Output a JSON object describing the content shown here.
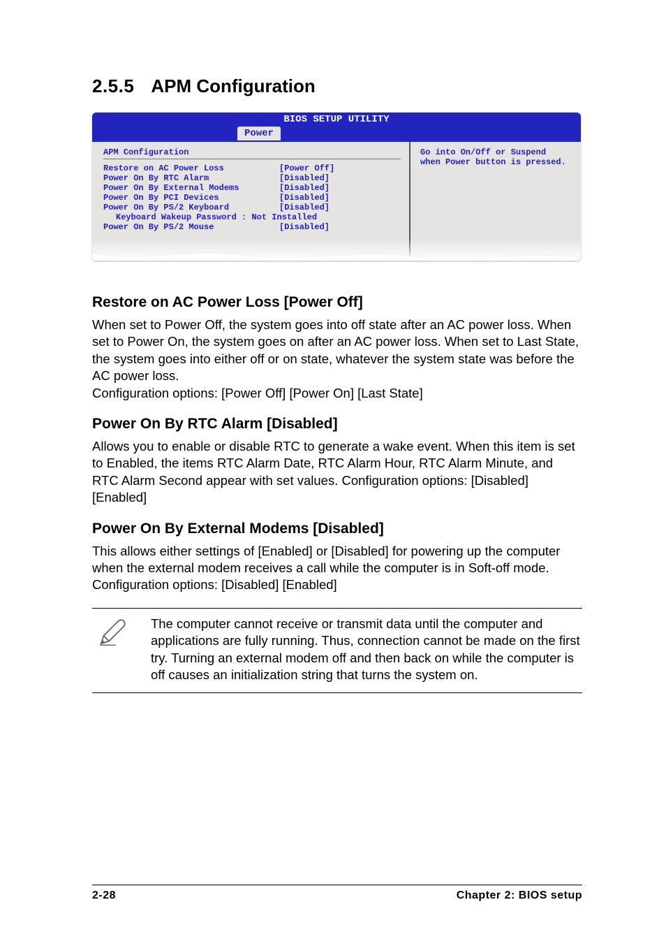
{
  "section": {
    "number": "2.5.5",
    "title": "APM Configuration"
  },
  "bios": {
    "title": "BIOS SETUP UTILITY",
    "tab": "Power",
    "panel_title": "APM Configuration",
    "help": "Go into On/Off or Suspend when Power button is pressed.",
    "rows": [
      {
        "label": "Restore on AC Power Loss",
        "value": "[Power Off]",
        "indent": false
      },
      {
        "label": "Power On By RTC Alarm",
        "value": "[Disabled]",
        "indent": false
      },
      {
        "label": "Power On By External Modems",
        "value": "[Disabled]",
        "indent": false
      },
      {
        "label": "Power On By PCI Devices",
        "value": "[Disabled]",
        "indent": false
      },
      {
        "label": "Power On By PS/2 Keyboard",
        "value": "[Disabled]",
        "indent": false
      },
      {
        "label": "Keyboard Wakeup Password : Not Installed",
        "value": "",
        "indent": true
      },
      {
        "label": "Power On By PS/2 Mouse",
        "value": "[Disabled]",
        "indent": false
      }
    ]
  },
  "sub1": {
    "heading": "Restore on AC Power Loss [Power Off]",
    "body": "When set to Power Off, the system goes into off state after an AC power loss. When set to Power On, the system goes on after an AC power loss. When set to Last State, the system goes into either off or on state, whatever the system state was before the AC power loss.\nConfiguration options: [Power Off] [Power On] [Last State]"
  },
  "sub2": {
    "heading": "Power On By RTC Alarm [Disabled]",
    "body": "Allows you to enable or disable RTC to generate a wake event. When this item is set to Enabled, the items RTC Alarm Date, RTC Alarm Hour, RTC Alarm Minute, and RTC Alarm Second appear with set values. Configuration options: [Disabled] [Enabled]"
  },
  "sub3": {
    "heading": "Power On By External Modems [Disabled]",
    "body": "This allows either settings of [Enabled] or [Disabled] for powering up the computer when the external modem receives a call while the computer is in Soft-off mode. Configuration options: [Disabled] [Enabled]"
  },
  "note": "The computer cannot receive or transmit data until the computer and applications are fully running. Thus, connection cannot be made on the first try. Turning an external modem off and then back on while the computer is off causes an initialization string that turns the system on.",
  "footer": {
    "left": "2-28",
    "right": "Chapter 2: BIOS setup"
  }
}
